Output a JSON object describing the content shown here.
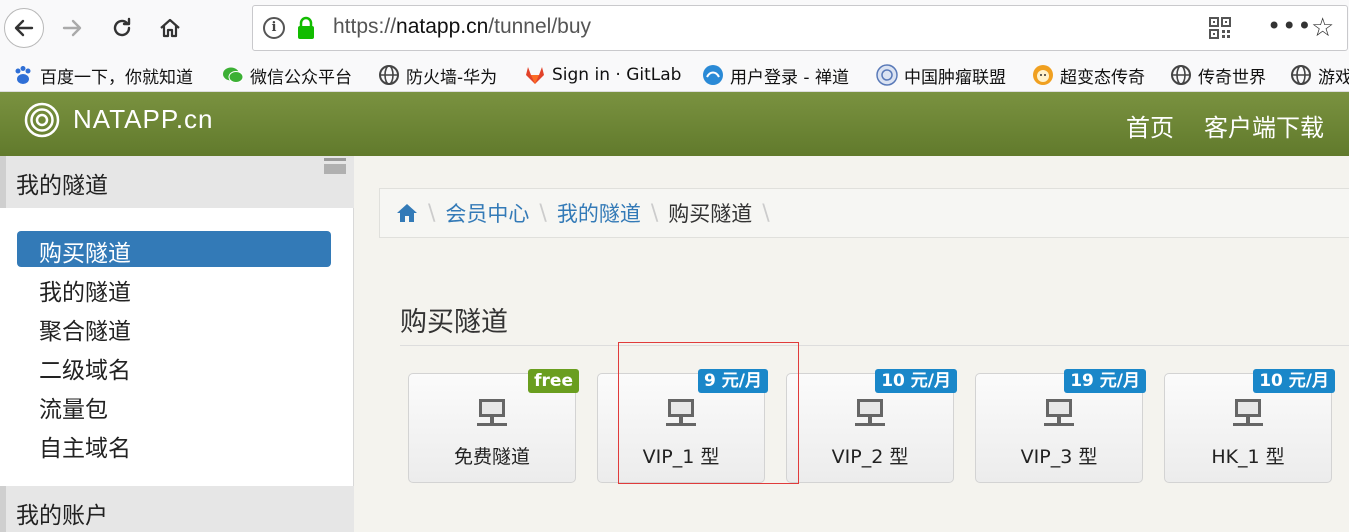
{
  "browser": {
    "url_prefix": "https://",
    "url_domain": "natapp.cn",
    "url_path": "/tunnel/buy",
    "info_glyph": "i",
    "menu_glyph": "•••",
    "star_glyph": "☆"
  },
  "bookmarks": [
    {
      "label": "百度一下，你就知道",
      "icon": "baidu-paw-icon",
      "color": "#2f6fd6"
    },
    {
      "label": "微信公众平台",
      "icon": "wechat-icon",
      "color": "#3cb034"
    },
    {
      "label": "防火墙-华为",
      "icon": "globe-icon",
      "color": "#444444"
    },
    {
      "label": "Sign in · GitLab",
      "icon": "gitlab-icon",
      "color": "#e2432a"
    },
    {
      "label": "用户登录 - 禅道",
      "icon": "chandao-icon",
      "color": "#2a8ad6"
    },
    {
      "label": "中国肿瘤联盟",
      "icon": "seal-icon",
      "color": "#5a7ab8"
    },
    {
      "label": "超变态传奇",
      "icon": "face-icon",
      "color": "#f0a020"
    },
    {
      "label": "传奇世界",
      "icon": "globe-icon",
      "color": "#444444"
    },
    {
      "label": "游戏",
      "icon": "globe-icon",
      "color": "#444444"
    }
  ],
  "site": {
    "logo_text": "NATAPP.cn",
    "nav": [
      "首页",
      "客户端下载"
    ]
  },
  "sidebar": {
    "section1": "我的隧道",
    "items": [
      "购买隧道",
      "我的隧道",
      "聚合隧道",
      "二级域名",
      "流量包",
      "自主域名"
    ],
    "active_index": 0,
    "section2": "我的账户"
  },
  "breadcrumb": {
    "items": [
      "会员中心",
      "我的隧道",
      "购买隧道"
    ]
  },
  "main": {
    "title": "购买隧道",
    "cards": [
      {
        "label": "免费隧道",
        "badge": "free",
        "badge_color": "#6a9e1f"
      },
      {
        "label": "VIP_1 型",
        "badge": "9 元/月",
        "badge_color": "#1a87c9"
      },
      {
        "label": "VIP_2 型",
        "badge": "10 元/月",
        "badge_color": "#1a87c9"
      },
      {
        "label": "VIP_3 型",
        "badge": "19 元/月",
        "badge_color": "#1a87c9"
      },
      {
        "label": "HK_1 型",
        "badge": "10 元/月",
        "badge_color": "#1a87c9"
      }
    ]
  }
}
